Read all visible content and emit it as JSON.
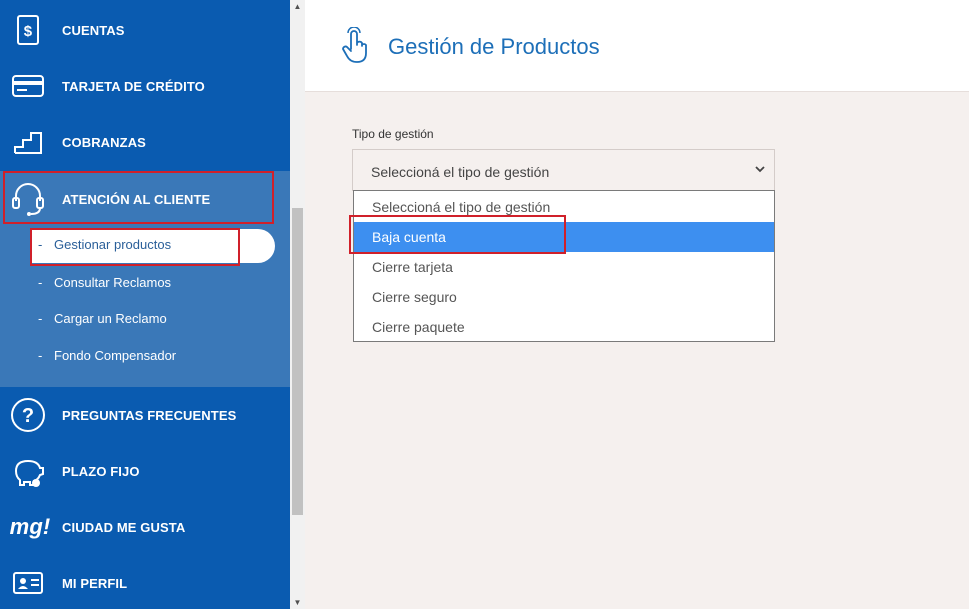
{
  "sidebar": {
    "items": [
      {
        "label": "CUENTAS",
        "icon": "dollar-card-icon"
      },
      {
        "label": "TARJETA DE CRÉDITO",
        "icon": "credit-card-icon"
      },
      {
        "label": "COBRANZAS",
        "icon": "stairs-icon"
      },
      {
        "label": "ATENCIÓN AL CLIENTE",
        "icon": "headset-icon"
      },
      {
        "label": "PREGUNTAS FRECUENTES",
        "icon": "question-icon"
      },
      {
        "label": "PLAZO FIJO",
        "icon": "piggy-bank-icon"
      },
      {
        "label": "CIUDAD ME GUSTA",
        "icon": "mg-logo"
      },
      {
        "label": "MI PERFIL",
        "icon": "id-card-icon"
      }
    ],
    "submenu": [
      {
        "dash": "-",
        "label": "Gestionar productos"
      },
      {
        "dash": "-",
        "label": "Consultar Reclamos"
      },
      {
        "dash": "-",
        "label": "Cargar un Reclamo"
      },
      {
        "dash": "-",
        "label": "Fondo Compensador"
      }
    ],
    "mg_logo_text": "mg!"
  },
  "header": {
    "title": "Gestión de Productos"
  },
  "form": {
    "label": "Tipo de gestión",
    "selected": "Seleccioná el tipo de gestión",
    "options": [
      "Seleccioná el tipo de gestión",
      "Baja cuenta",
      "Cierre tarjeta",
      "Cierre seguro",
      "Cierre paquete"
    ],
    "highlighted_option": "Baja cuenta"
  },
  "colors": {
    "sidebar": "#0a5bb0",
    "submenu": "#3a78b8",
    "accent": "#1d6fb8",
    "highlight": "#3d8ff0",
    "annotation": "#d0202a"
  }
}
